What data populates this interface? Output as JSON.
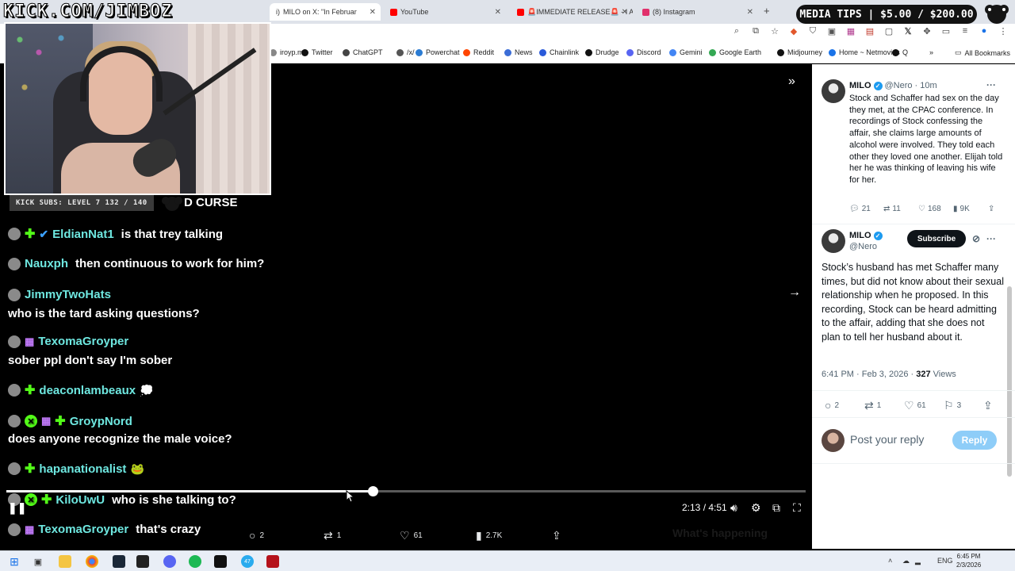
{
  "browser": {
    "tabs": [
      {
        "label": "MILO on X: \"In Februar",
        "fav": "#111111",
        "active": true
      },
      {
        "label": "YouTube",
        "fav": "#ff0000",
        "active": false
      },
      {
        "label": "🚨IMMEDIATE RELEASE🚨 - I A",
        "fav": "#ff0000",
        "active": false
      },
      {
        "label": "(8) Instagram",
        "fav": "#e1306c",
        "active": false
      }
    ],
    "tab_partial_prefix": "i)",
    "new_tab": "+",
    "bookmarks": [
      {
        "label": "iroyp.me",
        "icon": "globe-icon",
        "color": "#888888"
      },
      {
        "label": "Twitter",
        "icon": "x-icon",
        "color": "#111111"
      },
      {
        "label": "ChatGPT",
        "icon": "chatgpt-icon",
        "color": "#444444"
      },
      {
        "label": "/x/",
        "icon": "board-icon",
        "color": "#555555"
      },
      {
        "label": "Powerchat",
        "icon": "powerchat-icon",
        "color": "#2b7cd3"
      },
      {
        "label": "Reddit",
        "icon": "reddit-icon",
        "color": "#ff4500"
      },
      {
        "label": "News",
        "icon": "news-icon",
        "color": "#3b6dd6"
      },
      {
        "label": "Chainlink",
        "icon": "chainlink-icon",
        "color": "#2a5ada"
      },
      {
        "label": "Drudge",
        "icon": "drudge-icon",
        "color": "#111111"
      },
      {
        "label": "Discord",
        "icon": "discord-icon",
        "color": "#5865f2"
      },
      {
        "label": "Gemini",
        "icon": "gemini-icon",
        "color": "#4285f4"
      },
      {
        "label": "Google Earth",
        "icon": "earth-icon",
        "color": "#34a853"
      },
      {
        "label": "Midjourney",
        "icon": "midjourney-icon",
        "color": "#111111"
      },
      {
        "label": "Home ~ Netmovies",
        "icon": "netmovies-icon",
        "color": "#1a73e8"
      },
      {
        "label": "Q",
        "icon": "q-icon",
        "color": "#111111"
      }
    ],
    "all_bookmarks": "All Bookmarks"
  },
  "overlay": {
    "kick_url": "KICK.COM/JIMBOZ",
    "media_tips": "MEDIA TIPS | $5.00 / $200.00",
    "kick_subs": "KICK SUBS: LEVEL 7 132 / 140",
    "curse_text": "D CURSE"
  },
  "chat": [
    {
      "user": "EldianNat1",
      "msg": "is that trey talking",
      "badges": [
        "green",
        "blue"
      ],
      "inline": true
    },
    {
      "user": "Nauxph",
      "msg": "then continuous to work for him?",
      "badges": [],
      "inline": true
    },
    {
      "user": "JimmyTwoHats",
      "msg": "who is the tard asking questions?",
      "badges": [],
      "inline": false
    },
    {
      "user": "TexomaGroyper",
      "msg": "sober ppl don't say I'm sober",
      "badges": [
        "gift"
      ],
      "inline": false
    },
    {
      "user": "deaconlambeaux",
      "msg": "",
      "badges": [
        "green"
      ],
      "inline": true,
      "emote": "💭"
    },
    {
      "user": "GroypNord",
      "msg": "does anyone recognize the male voice?",
      "badges": [
        "x",
        "gift",
        "green"
      ],
      "inline": false
    },
    {
      "user": "hapanationalist",
      "msg": "",
      "badges": [
        "green"
      ],
      "inline": true,
      "emote": "🐸"
    },
    {
      "user": "KiloUwU",
      "msg": "who is she talking to?",
      "badges": [
        "x",
        "green"
      ],
      "inline": true
    },
    {
      "user": "TexomaGroyper",
      "msg": "that's crazy",
      "badges": [
        "gift"
      ],
      "inline": true
    }
  ],
  "video": {
    "time": "2:13 / 4:51",
    "progress": 0.458,
    "replies": "2",
    "reposts": "1",
    "likes": "61",
    "views": "2.7K",
    "whats_happening": "What's happening"
  },
  "tweet1": {
    "name": "MILO",
    "handle": "@Nero",
    "age": "· 10m",
    "text": "Stock and Schaffer had sex on the day they met, at the CPAC conference. In recordings of Stock confessing the affair, she claims large amounts of alcohol were involved. They told each other they loved one another. Elijah told her he was thinking of leaving his wife for her.",
    "replies": "21",
    "reposts": "11",
    "likes": "168",
    "views": "9K"
  },
  "tweet2": {
    "name": "MILO",
    "handle": "@Nero",
    "subscribe": "Subscribe",
    "text": "Stock’s husband has met Schaffer many times, but did not know about their sexual relationship when he proposed. In this recording, Stock can be heard admitting to the affair, adding that she does not plan to tell her husband about it.",
    "time": "6:41 PM · Feb 3, 2026 ·",
    "views_count": "327",
    "views_label": "Views",
    "replies": "2",
    "reposts": "1",
    "likes": "61",
    "bookmarks": "3"
  },
  "reply": {
    "placeholder": "Post your reply",
    "button": "Reply"
  },
  "taskbar": {
    "lang": "ENG",
    "time": "6:45 PM",
    "date": "2/3/2026",
    "badge": "47"
  },
  "colors": {
    "kick_green": "#53fc18",
    "username": "#6ee7e0",
    "x_blue": "#1d9bf0"
  }
}
